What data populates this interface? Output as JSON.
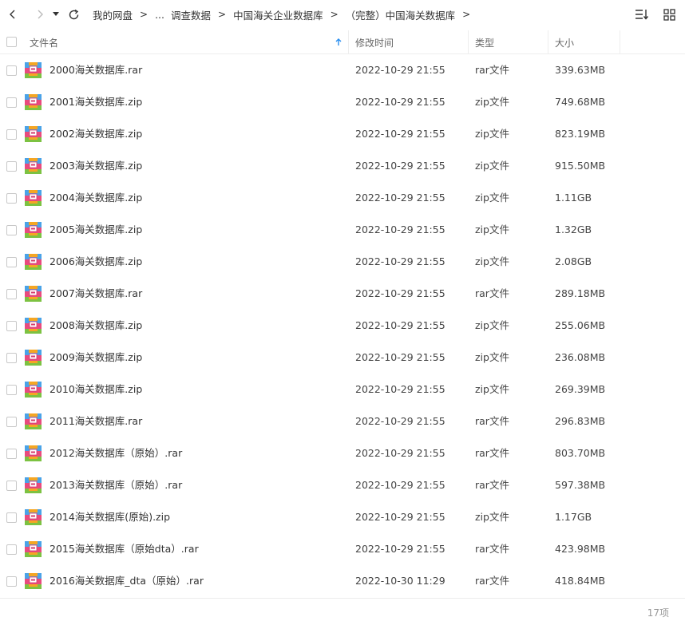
{
  "breadcrumb": [
    "我的网盘",
    "...",
    "调查数据",
    "中国海关企业数据库",
    "（完整）中国海关数据库"
  ],
  "columns": {
    "name": "文件名",
    "modified": "修改时间",
    "type": "类型",
    "size": "大小"
  },
  "files": [
    {
      "name": "2000海关数据库.rar",
      "modified": "2022-10-29 21:55",
      "type": "rar文件",
      "size": "339.63MB"
    },
    {
      "name": "2001海关数据库.zip",
      "modified": "2022-10-29 21:55",
      "type": "zip文件",
      "size": "749.68MB"
    },
    {
      "name": "2002海关数据库.zip",
      "modified": "2022-10-29 21:55",
      "type": "zip文件",
      "size": "823.19MB"
    },
    {
      "name": "2003海关数据库.zip",
      "modified": "2022-10-29 21:55",
      "type": "zip文件",
      "size": "915.50MB"
    },
    {
      "name": "2004海关数据库.zip",
      "modified": "2022-10-29 21:55",
      "type": "zip文件",
      "size": "1.11GB"
    },
    {
      "name": "2005海关数据库.zip",
      "modified": "2022-10-29 21:55",
      "type": "zip文件",
      "size": "1.32GB"
    },
    {
      "name": "2006海关数据库.zip",
      "modified": "2022-10-29 21:55",
      "type": "zip文件",
      "size": "2.08GB"
    },
    {
      "name": "2007海关数据库.rar",
      "modified": "2022-10-29 21:55",
      "type": "rar文件",
      "size": "289.18MB"
    },
    {
      "name": "2008海关数据库.zip",
      "modified": "2022-10-29 21:55",
      "type": "zip文件",
      "size": "255.06MB"
    },
    {
      "name": "2009海关数据库.zip",
      "modified": "2022-10-29 21:55",
      "type": "zip文件",
      "size": "236.08MB"
    },
    {
      "name": "2010海关数据库.zip",
      "modified": "2022-10-29 21:55",
      "type": "zip文件",
      "size": "269.39MB"
    },
    {
      "name": "2011海关数据库.rar",
      "modified": "2022-10-29 21:55",
      "type": "rar文件",
      "size": "296.83MB"
    },
    {
      "name": "2012海关数据库（原始）.rar",
      "modified": "2022-10-29 21:55",
      "type": "rar文件",
      "size": "803.70MB"
    },
    {
      "name": "2013海关数据库（原始）.rar",
      "modified": "2022-10-29 21:55",
      "type": "rar文件",
      "size": "597.38MB"
    },
    {
      "name": "2014海关数据库(原始).zip",
      "modified": "2022-10-29 21:55",
      "type": "zip文件",
      "size": "1.17GB"
    },
    {
      "name": "2015海关数据库（原始dta）.rar",
      "modified": "2022-10-29 21:55",
      "type": "rar文件",
      "size": "423.98MB"
    },
    {
      "name": "2016海关数据库_dta（原始）.rar",
      "modified": "2022-10-30 11:29",
      "type": "rar文件",
      "size": "418.84MB"
    }
  ],
  "footer": {
    "count": "17项"
  },
  "icons": {
    "back": "chevron-left-icon",
    "forward": "chevron-right-icon",
    "history": "caret-down-icon",
    "refresh": "refresh-icon",
    "sort": "sort-list-icon",
    "view": "grid-view-icon",
    "sort_indicator": "arrow-up-icon",
    "archive": "archive-file-icon"
  },
  "colors": {
    "accent": "#2b8ff0",
    "icon_top": "#e94b7e",
    "icon_left": "#4aa3e8",
    "icon_bottom": "#7cc242",
    "icon_right": "#f5a623"
  }
}
